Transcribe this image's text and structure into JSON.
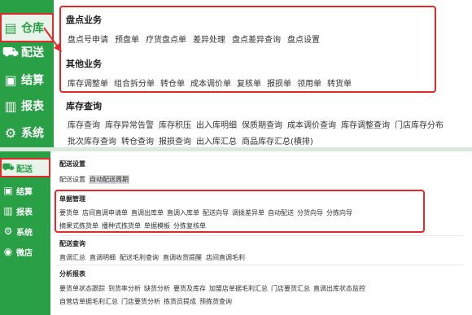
{
  "top": {
    "sidebar": [
      {
        "label": "仓库",
        "icon": "warehouse-icon",
        "glyph": "▤"
      },
      {
        "label": "配送",
        "icon": "truck-icon",
        "glyph": "⛟"
      },
      {
        "label": "结算",
        "icon": "settle-icon",
        "glyph": "▣"
      },
      {
        "label": "报表",
        "icon": "chart-icon",
        "glyph": "▥"
      },
      {
        "label": "系统",
        "icon": "gear-icon",
        "glyph": "⚙"
      }
    ],
    "sections": [
      {
        "title": "盘点业务",
        "items": [
          "盘点号申请",
          "预盘单",
          "疗货盘点单",
          "差异处理",
          "盘点差异查询",
          "盘点设置"
        ]
      },
      {
        "title": "其他业务",
        "items": [
          "库存调整单",
          "组合拆分单",
          "转仓单",
          "成本调价单",
          "复核单",
          "报损单",
          "领用单",
          "转货单"
        ]
      },
      {
        "title": "库存查询",
        "items_row1": [
          "库存查询",
          "库存异常告警",
          "库存积压",
          "出入库明细",
          "保质期查询",
          "成本调价查询",
          "库存调整查询",
          "门店库存分布"
        ],
        "items_row2": [
          "批次库存查询",
          "转仓查询",
          "报损查询",
          "出入库汇总",
          "商品库存汇总(横排)"
        ]
      }
    ]
  },
  "bottom": {
    "sidebar": [
      {
        "label": "配送",
        "icon": "truck-icon",
        "glyph": "⛟"
      },
      {
        "label": "结算",
        "icon": "settle-icon",
        "glyph": "▣"
      },
      {
        "label": "报表",
        "icon": "chart-icon",
        "glyph": "▥"
      },
      {
        "label": "系统",
        "icon": "gear-icon",
        "glyph": "⚙"
      },
      {
        "label": "微店",
        "icon": "shop-icon",
        "glyph": "◉"
      }
    ],
    "sections": [
      {
        "title": "配送设置",
        "items": [
          "配送设置",
          "自动配送周期"
        ]
      },
      {
        "title": "单据管理",
        "items_row1": [
          "要货单",
          "店间直调申请单",
          "直调出库单",
          "直调入库单",
          "配送向导",
          "调拨差异单",
          "自动配送",
          "分货向导",
          "分拣向导"
        ],
        "items_row2": [
          "摘果式拣货单",
          "播种式拣货单",
          "单据模板",
          "分拣复核单"
        ]
      },
      {
        "title": "配送查询",
        "items": [
          "直调汇总",
          "直调明细",
          "配送毛利查询",
          "直调收货提醒",
          "店间直调毛利"
        ]
      },
      {
        "title": "分析报表",
        "items_row1": [
          "要货单状态跟踪",
          "到货率分析",
          "缺货分析",
          "要货及库存",
          "加盟店单据毛利汇总",
          "门店要货汇总",
          "直调出库状态监控"
        ],
        "items_row2": [
          "自营店单据毛利汇总",
          "门店要货分析",
          "拣货员提成",
          "预拣货查询"
        ]
      }
    ]
  }
}
